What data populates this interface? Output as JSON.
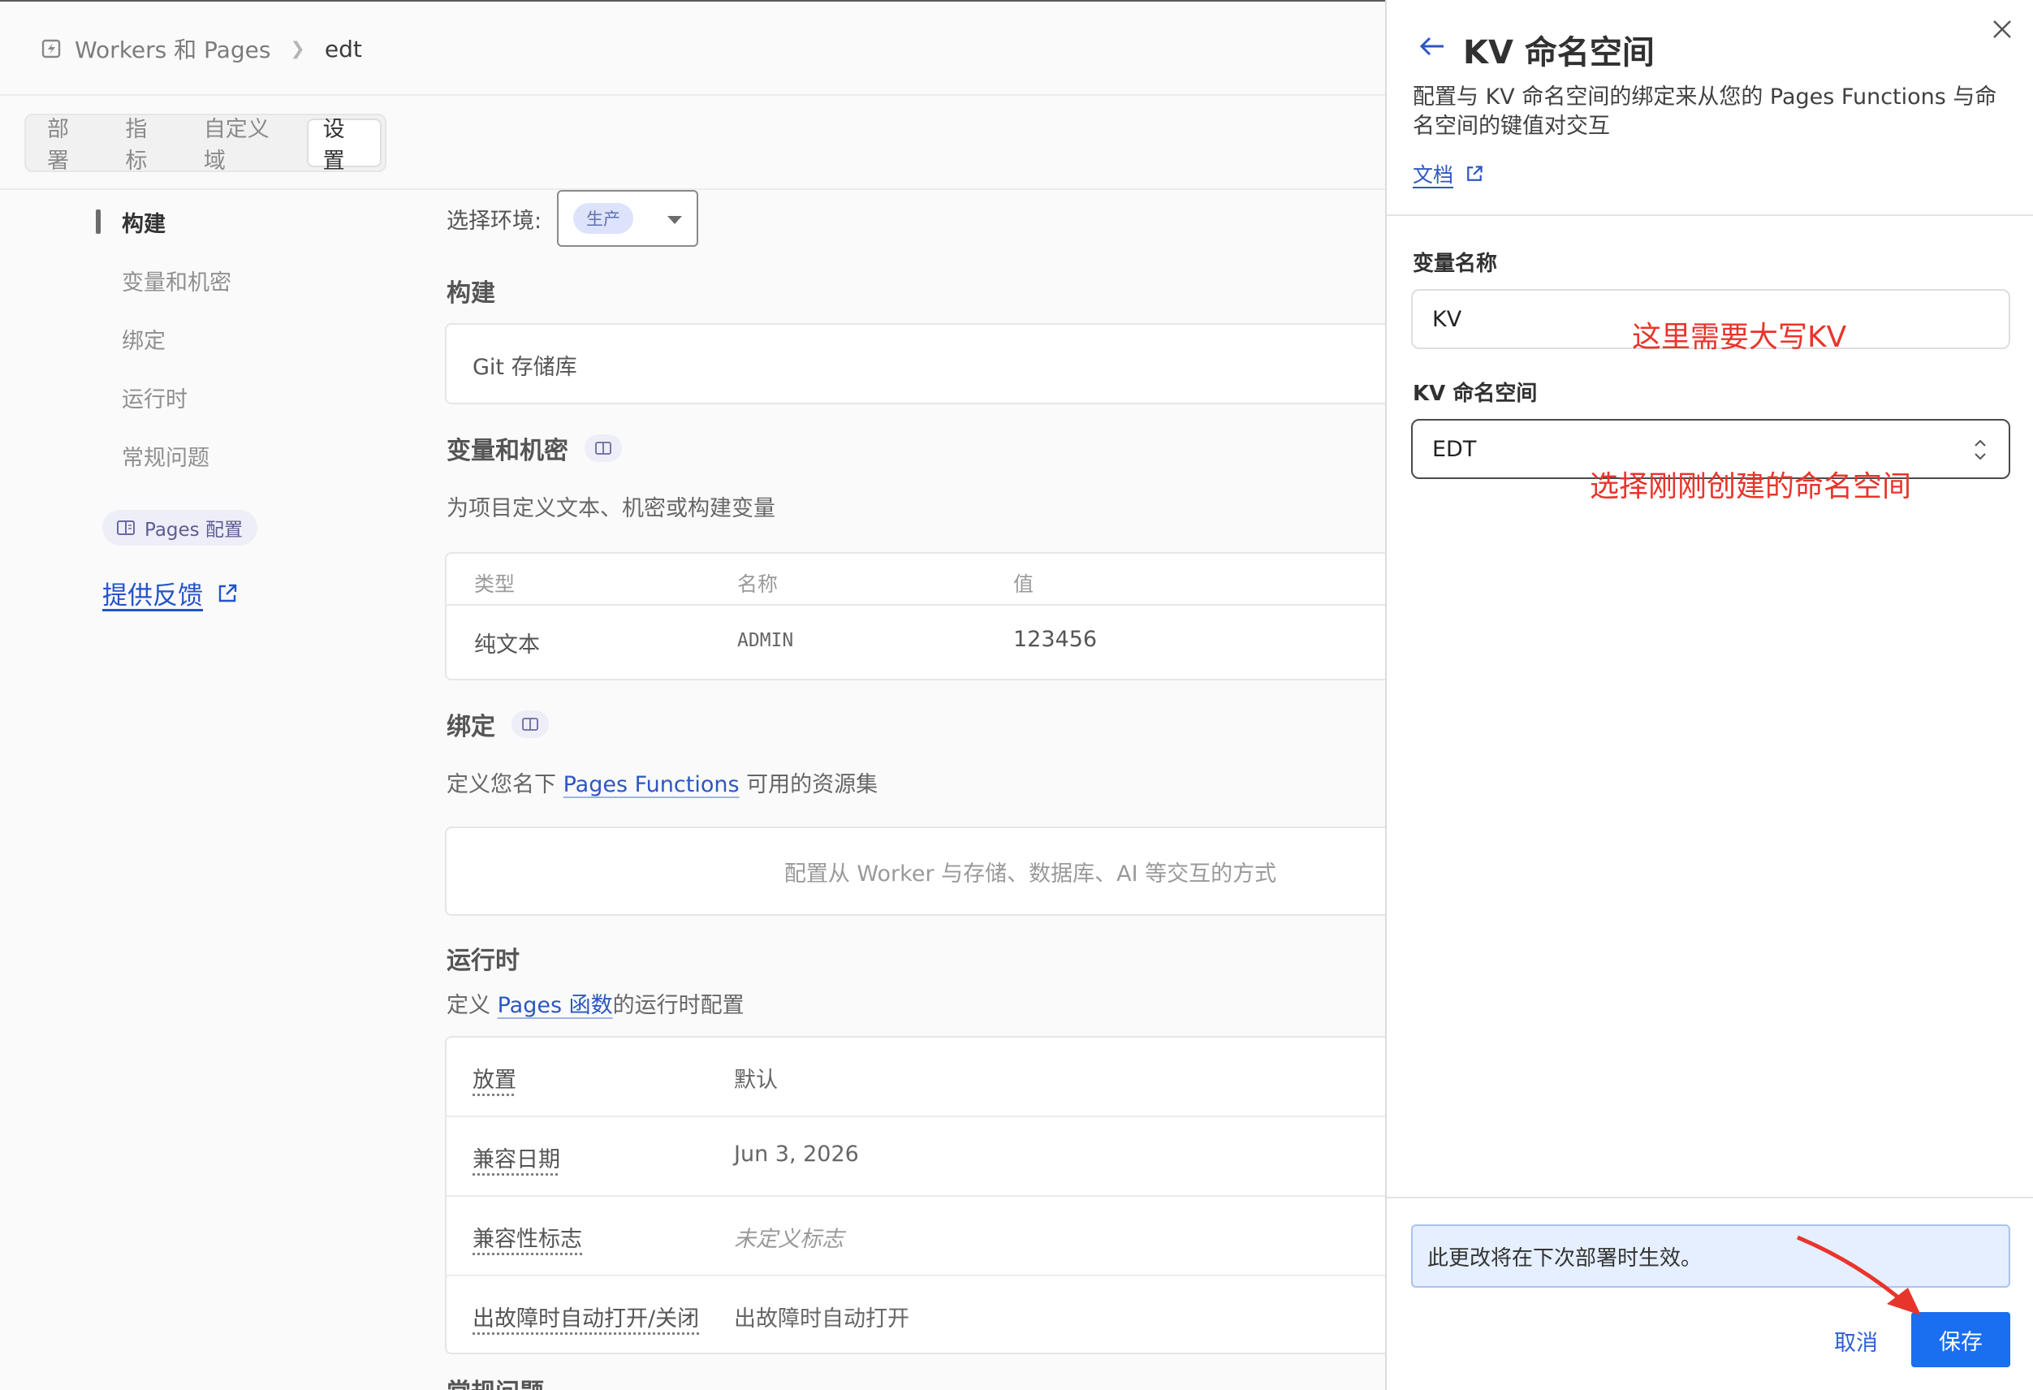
{
  "breadcrumb": {
    "app": "Workers 和 Pages",
    "project": "edt"
  },
  "tabs": [
    "部署",
    "指标",
    "自定义域",
    "设置"
  ],
  "sidenav": {
    "items": [
      "构建",
      "变量和机密",
      "绑定",
      "运行时",
      "常规问题"
    ],
    "pages_config": "Pages 配置",
    "feedback": "提供反馈"
  },
  "env": {
    "label": "选择环境:",
    "value": "生产"
  },
  "build": {
    "title": "构建",
    "git": "Git 存储库"
  },
  "vars": {
    "title": "变量和机密",
    "desc": "为项目定义文本、机密或构建变量",
    "headers": [
      "类型",
      "名称",
      "值"
    ],
    "row": [
      "纯文本",
      "ADMIN",
      "123456"
    ]
  },
  "bindings": {
    "title": "绑定",
    "desc_before": "定义您名下 ",
    "desc_link": "Pages Functions",
    "desc_after": " 可用的资源集",
    "empty": "配置从 Worker 与存储、数据库、AI 等交互的方式"
  },
  "runtime": {
    "title": "运行时",
    "desc_before": "定义 ",
    "desc_link": "Pages 函数",
    "desc_after": "的运行时配置",
    "rows": [
      {
        "key": "放置",
        "value": "默认"
      },
      {
        "key": "兼容日期",
        "value": "Jun 3, 2026"
      },
      {
        "key": "兼容性标志",
        "value": "未定义标志"
      },
      {
        "key": "出故障时自动打开/关闭",
        "value": "出故障时自动打开"
      }
    ],
    "next_title": "常规问题"
  },
  "panel": {
    "title": "KV 命名空间",
    "desc": "配置与 KV 命名空间的绑定来从您的 Pages Functions 与命名空间的键值对交互",
    "docs": "文档",
    "var_label": "变量名称",
    "var_value": "KV",
    "ns_label": "KV 命名空间",
    "ns_value": "EDT",
    "notice": "此更改将在下次部署时生效。",
    "cancel": "取消",
    "save": "保存"
  },
  "annotations": {
    "uppercase_note": "这里需要大写KV",
    "select_note": "选择刚刚创建的命名空间"
  },
  "colors": {
    "accent": "#1a6ef0",
    "annotation": "#e8352c",
    "link": "#2d57c0"
  }
}
